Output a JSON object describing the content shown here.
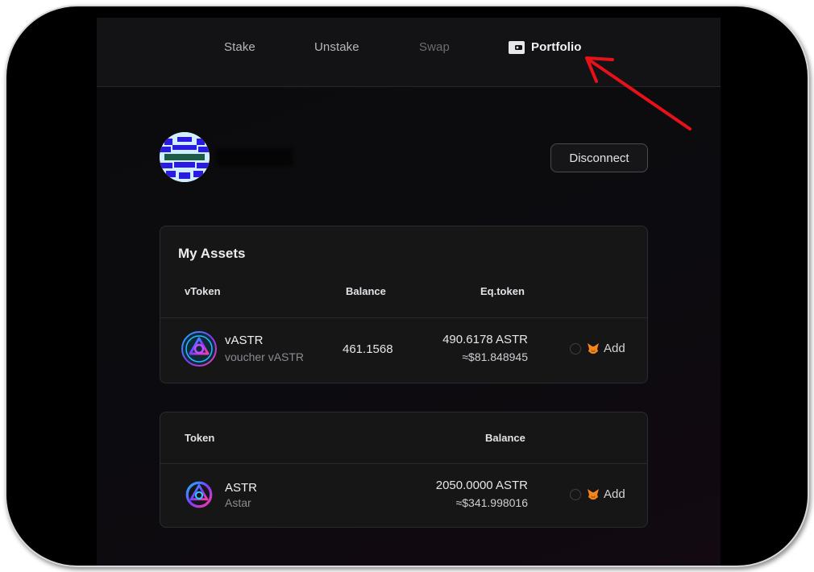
{
  "nav": {
    "items": [
      {
        "label": "Stake"
      },
      {
        "label": "Unstake"
      },
      {
        "label": "Swap"
      },
      {
        "label": "Portfolio"
      }
    ],
    "active": "Portfolio"
  },
  "account": {
    "disconnect_label": "Disconnect"
  },
  "my_assets": {
    "title": "My Assets",
    "columns": {
      "vtoken": "vToken",
      "balance": "Balance",
      "eq_token": "Eq.token"
    },
    "rows": [
      {
        "name": "vASTR",
        "subtitle": "voucher vASTR",
        "balance": "461.1568",
        "eq_token": "490.6178 ASTR",
        "usd": "≈$81.848945",
        "add_label": "Add"
      }
    ]
  },
  "tokens": {
    "columns": {
      "token": "Token",
      "balance": "Balance"
    },
    "rows": [
      {
        "name": "ASTR",
        "subtitle": "Astar",
        "balance": "2050.0000 ASTR",
        "usd": "≈$341.998016",
        "add_label": "Add"
      }
    ]
  },
  "icons": {
    "portfolio": "wallet-icon",
    "token": "astar-logo-icon",
    "add_wallet": "metamask-fox-icon",
    "history": "clock-icon",
    "annotation": "red-arrow"
  },
  "colors": {
    "background": "#000000",
    "panel": "#161617",
    "annotation_arrow": "#e8111a",
    "metamask_orange": "#f6851b"
  }
}
